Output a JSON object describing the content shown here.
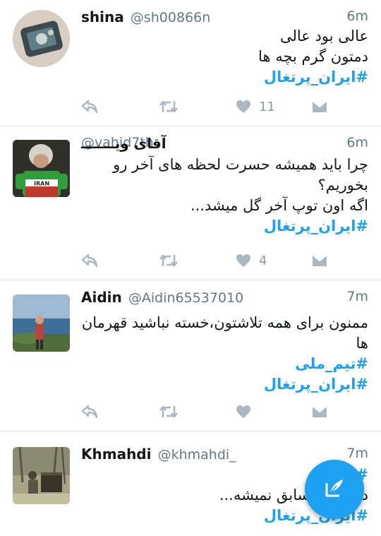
{
  "feed": {
    "tweets": [
      {
        "name": "shina",
        "handle": "@sh00866n",
        "time": "6m",
        "lines": [
          "عالی بود عالی",
          "دمتون گرم بچه ها"
        ],
        "hashtags": [
          "#ایران_پرتغال"
        ],
        "like_count": "11"
      },
      {
        "name": "آقای ویـــــــ",
        "handle": "@vahid7th",
        "time": "6m",
        "lines": [
          "چرا باید همیشه حسرت لحظه های آخر رو",
          "بخوریم؟",
          "اگه اون توپ آخر گل میشد..."
        ],
        "hashtags": [
          "#ایران_پرتغال"
        ],
        "like_count": "4",
        "avatar_label": "IRAN"
      },
      {
        "name": "Aidin",
        "handle": "@Aidin65537010",
        "time": "7m",
        "lines": [
          "ممنون برای همه تلاشتون،خسته نباشید قهرمان",
          "ها"
        ],
        "hashtags": [
          "#تیم_ملی",
          "#ایران_پرتغال"
        ],
        "like_count": ""
      },
      {
        "name": "Khmahdi",
        "handle": "@khmahdi_",
        "time": "7m",
        "lines": [
          "#",
          "د  رونالدو سابق نمیشه...",
          ""
        ],
        "hashtags": [
          "#ایران_پرتغال"
        ],
        "like_count": ""
      }
    ]
  },
  "icons": {
    "reply": "reply-icon",
    "retweet": "retweet-icon",
    "like": "heart-icon",
    "dm": "direct-message-icon",
    "compose": "compose-tweet-icon"
  },
  "colors": {
    "accent": "#1da1f2",
    "text": "#14171a",
    "muted": "#657786",
    "icon": "#aab8c2",
    "divider": "#e1e8ed"
  }
}
